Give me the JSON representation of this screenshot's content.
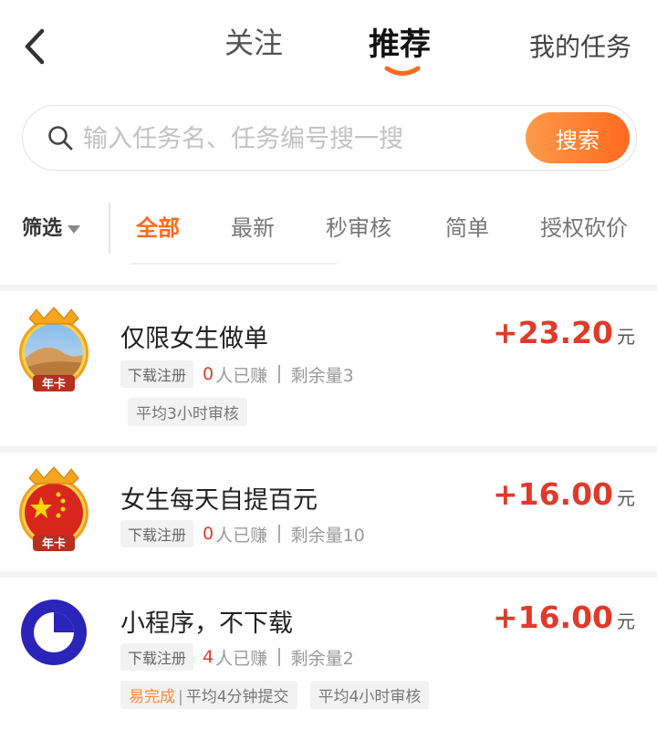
{
  "nav": {
    "tabs": [
      {
        "label": "关注"
      },
      {
        "label": "推荐"
      },
      {
        "label": "我的任务"
      }
    ],
    "active_tab": "推荐"
  },
  "search": {
    "placeholder": "输入任务名、任务编号搜一搜",
    "button_label": "搜索"
  },
  "filter": {
    "label": "筛选",
    "categories": [
      "全部",
      "最新",
      "秒审核",
      "简单",
      "授权砍价"
    ],
    "active_category": "全部"
  },
  "colors": {
    "accent": "#ff6a1e",
    "reward": "#e03a2b"
  },
  "tasks": [
    {
      "title": "仅限女生做单",
      "reward": "+23.20",
      "unit": "元",
      "type_tag": "下载注册",
      "earned_count": "0",
      "earned_suffix": "人已赚",
      "remaining": "剩余量3",
      "badge": "年卡",
      "avatar_icon": "desert-dunes-avatar",
      "extra_tags": [
        {
          "text": "平均3小时审核"
        }
      ]
    },
    {
      "title": "女生每天自提百元",
      "reward": "+16.00",
      "unit": "元",
      "type_tag": "下载注册",
      "earned_count": "0",
      "earned_suffix": "人已赚",
      "remaining": "剩余量10",
      "badge": "年卡",
      "avatar_icon": "china-flag-avatar",
      "extra_tags": []
    },
    {
      "title": "小程序，不下载",
      "reward": "+16.00",
      "unit": "元",
      "type_tag": "下载注册",
      "earned_count": "4",
      "earned_suffix": "人已赚",
      "remaining": "剩余量2",
      "avatar_icon": "blue-ring-logo",
      "extra_tags": [
        {
          "easy": "易完成",
          "text": "平均4分钟提交"
        },
        {
          "text": "平均4小时审核"
        }
      ]
    }
  ]
}
